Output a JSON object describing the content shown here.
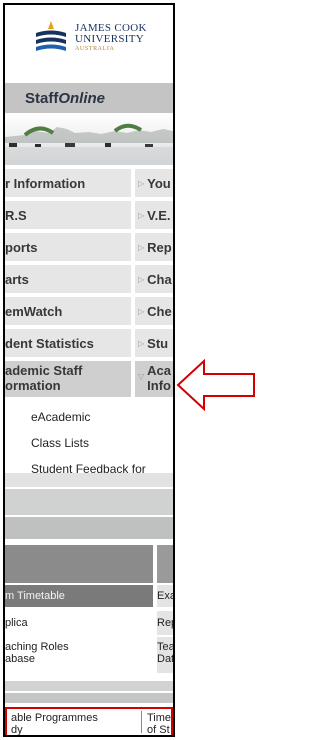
{
  "header": {
    "university_line1": "JAMES COOK",
    "university_line2": "UNIVERSITY",
    "country": "AUSTRALIA",
    "staff_online_prefix": "Staff",
    "staff_online_suffix": "Online"
  },
  "menu": {
    "rows": [
      {
        "left": "r Information",
        "right": "You"
      },
      {
        "left": "R.S",
        "right": "V.E."
      },
      {
        "left": "ports",
        "right": "Rep"
      },
      {
        "left": "arts",
        "right": "Cha"
      },
      {
        "left": "emWatch",
        "right": "Che"
      },
      {
        "left": "dent Statistics",
        "right": "Stu"
      },
      {
        "left": "ademic Staff",
        "left2": "ormation",
        "right": "Aca",
        "right2": "Info"
      }
    ]
  },
  "submenu": {
    "items": [
      "eAcademic",
      "Class Lists",
      "Student Feedback for"
    ]
  },
  "lower": {
    "timetable": "m Timetable",
    "timetable_right": "Exa",
    "replica": "plica",
    "replica_right": "Rep",
    "teaching_roles": "aching Roles",
    "teaching_roles2": "abase",
    "teaching_right": "Tea",
    "teaching_right2": "Dat"
  },
  "bottom": {
    "left_line1": "able Programmes",
    "left_line2": "dy",
    "right_line1": "Time",
    "right_line2": "of St"
  },
  "colors": {
    "annotation_red": "#d40000",
    "jcu_navy": "#16335e",
    "jcu_gold": "#b08a2e",
    "menu_bg": "#e6e6e6",
    "bar_gray": "#c4c4c4"
  }
}
